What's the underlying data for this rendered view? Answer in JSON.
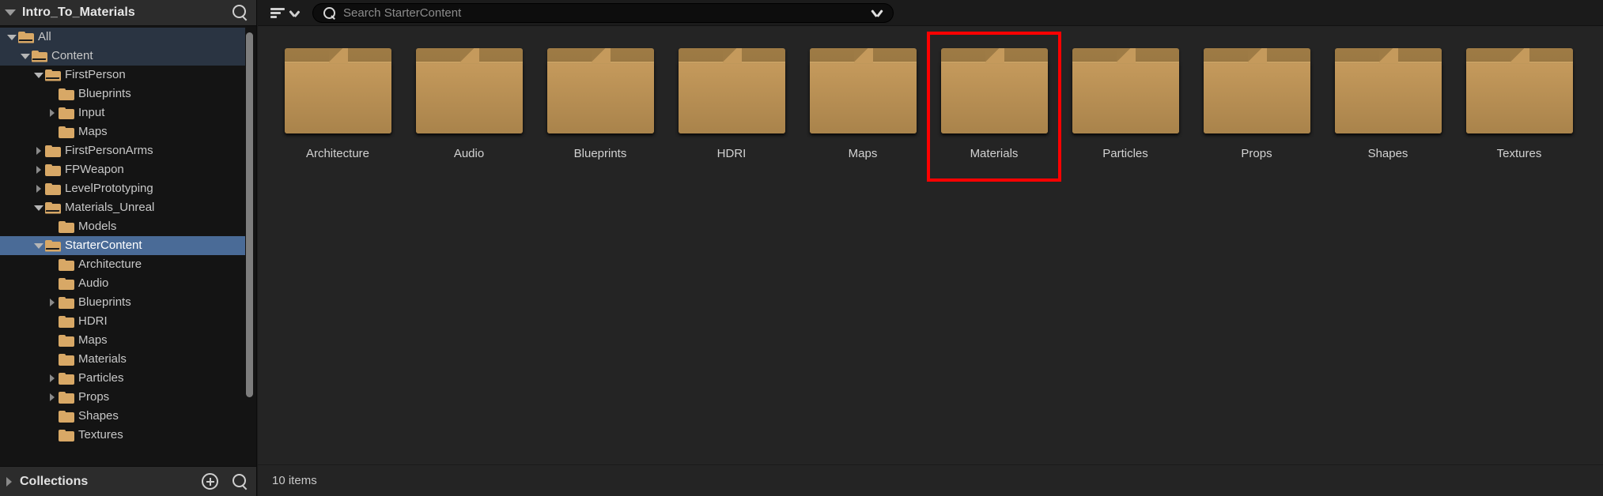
{
  "sidebar": {
    "title": "Intro_To_Materials",
    "search_icon": "search-icon",
    "expand_icon": "triangle-down-icon",
    "tree": [
      {
        "label": "All",
        "depth": 0,
        "arrow": "down",
        "folder": "open",
        "state": "soft"
      },
      {
        "label": "Content",
        "depth": 1,
        "arrow": "down",
        "folder": "open",
        "state": "soft"
      },
      {
        "label": "FirstPerson",
        "depth": 2,
        "arrow": "down",
        "folder": "open",
        "state": "none"
      },
      {
        "label": "Blueprints",
        "depth": 3,
        "arrow": "none",
        "folder": "closed",
        "state": "none"
      },
      {
        "label": "Input",
        "depth": 3,
        "arrow": "right",
        "folder": "closed",
        "state": "none"
      },
      {
        "label": "Maps",
        "depth": 3,
        "arrow": "none",
        "folder": "closed",
        "state": "none"
      },
      {
        "label": "FirstPersonArms",
        "depth": 2,
        "arrow": "right",
        "folder": "closed",
        "state": "none"
      },
      {
        "label": "FPWeapon",
        "depth": 2,
        "arrow": "right",
        "folder": "closed",
        "state": "none"
      },
      {
        "label": "LevelPrototyping",
        "depth": 2,
        "arrow": "right",
        "folder": "closed",
        "state": "none"
      },
      {
        "label": "Materials_Unreal",
        "depth": 2,
        "arrow": "down",
        "folder": "open",
        "state": "none"
      },
      {
        "label": "Models",
        "depth": 3,
        "arrow": "none",
        "folder": "closed",
        "state": "none"
      },
      {
        "label": "StarterContent",
        "depth": 2,
        "arrow": "down",
        "folder": "open",
        "state": "selected"
      },
      {
        "label": "Architecture",
        "depth": 3,
        "arrow": "none",
        "folder": "closed",
        "state": "none"
      },
      {
        "label": "Audio",
        "depth": 3,
        "arrow": "none",
        "folder": "closed",
        "state": "none"
      },
      {
        "label": "Blueprints",
        "depth": 3,
        "arrow": "right",
        "folder": "closed",
        "state": "none"
      },
      {
        "label": "HDRI",
        "depth": 3,
        "arrow": "none",
        "folder": "closed",
        "state": "none"
      },
      {
        "label": "Maps",
        "depth": 3,
        "arrow": "none",
        "folder": "closed",
        "state": "none"
      },
      {
        "label": "Materials",
        "depth": 3,
        "arrow": "none",
        "folder": "closed",
        "state": "none"
      },
      {
        "label": "Particles",
        "depth": 3,
        "arrow": "right",
        "folder": "closed",
        "state": "none"
      },
      {
        "label": "Props",
        "depth": 3,
        "arrow": "right",
        "folder": "closed",
        "state": "none"
      },
      {
        "label": "Shapes",
        "depth": 3,
        "arrow": "none",
        "folder": "closed",
        "state": "none"
      },
      {
        "label": "Textures",
        "depth": 3,
        "arrow": "none",
        "folder": "closed",
        "state": "none"
      }
    ],
    "collections": {
      "label": "Collections",
      "expand_icon": "triangle-right-icon",
      "add_icon": "plus-circle-icon",
      "search_icon": "search-icon"
    }
  },
  "toolbar": {
    "filter_icon": "filter-icon",
    "filter_chevron_icon": "chevron-down-icon",
    "search": {
      "icon": "search-icon",
      "placeholder": "Search StarterContent",
      "value": "",
      "dropdown_icon": "chevron-down-icon"
    }
  },
  "content": {
    "tiles": [
      {
        "label": "Architecture",
        "icon": "folder-icon"
      },
      {
        "label": "Audio",
        "icon": "folder-icon"
      },
      {
        "label": "Blueprints",
        "icon": "folder-icon"
      },
      {
        "label": "HDRI",
        "icon": "folder-icon"
      },
      {
        "label": "Maps",
        "icon": "folder-icon"
      },
      {
        "label": "Materials",
        "icon": "folder-icon"
      },
      {
        "label": "Particles",
        "icon": "folder-icon"
      },
      {
        "label": "Props",
        "icon": "folder-icon"
      },
      {
        "label": "Shapes",
        "icon": "folder-icon"
      },
      {
        "label": "Textures",
        "icon": "folder-icon"
      }
    ],
    "annotation": {
      "target": "Materials",
      "color": "#fe0000"
    }
  },
  "status": {
    "text": "10 items"
  },
  "colors": {
    "selection_blue": "#4a6b97",
    "soft_highlight": "#2a3442",
    "folder_gold": "#c59a5c",
    "annotation_red": "#fe0000",
    "panel_bg": "#242424",
    "sidebar_bg": "#141414"
  }
}
